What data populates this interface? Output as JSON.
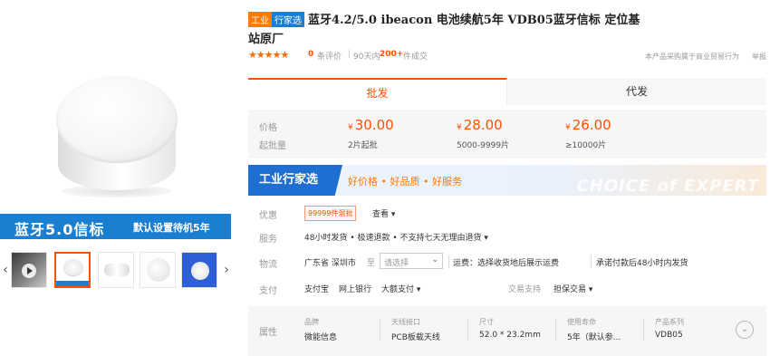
{
  "gallery": {
    "banner_title": "蓝牙5.0信标",
    "banner_subtitle": "默认设置待机5年",
    "prev_arrow": "‹",
    "next_arrow": "›"
  },
  "product": {
    "tag_industry": "工业",
    "tag_select": "行家选",
    "title": "蓝牙4.2/5.0 ibeacon 电池续航5年 VDB05蓝牙信标 定位基站原厂"
  },
  "rating": {
    "stars": "★★★★★",
    "score": "0",
    "reviews_label": "条评价",
    "separator": "|",
    "sold_label": "90天内",
    "sold_count": "200+",
    "sold_unit": "件成交",
    "trade_assurance": "本产品采购属于商业贸易行为",
    "report": "举报"
  },
  "tabs": [
    {
      "label": "批发"
    },
    {
      "label": "代发"
    }
  ],
  "price": {
    "price_label": "价格",
    "moq_label": "起批量",
    "currency": "¥",
    "tiers": [
      {
        "price": "30.00",
        "qty": "2片起批"
      },
      {
        "price": "28.00",
        "qty": "5000-9999片"
      },
      {
        "price": "26.00",
        "qty": "≥10000片"
      }
    ]
  },
  "expert": {
    "label": "工业行家选",
    "slogan": "好价格 • 好品质 • 好服务",
    "watermark": "CHOICE of EXPERT"
  },
  "promo": {
    "label": "优惠",
    "badge": "99999件混批",
    "view": "查看 ▾"
  },
  "service": {
    "label": "服务",
    "text": "48小时发货 • 极速退款 • 不支持七天无理由退货 ▾"
  },
  "shipping": {
    "label": "物流",
    "region": "广东省 深圳市",
    "to": "至",
    "select_placeholder": "请选择",
    "fee": "运费：选择收货地后展示运费",
    "promise": "承诺付款后48小时内发货"
  },
  "payment": {
    "label": "支付",
    "methods": [
      "支付宝",
      "网上银行",
      "大额支付 ▾"
    ],
    "trade_label": "交易支持",
    "trade_value": "担保交易 ▾"
  },
  "attributes": {
    "label": "属性",
    "items": [
      {
        "name": "品牌",
        "value": "微能信息"
      },
      {
        "name": "天线接口",
        "value": "PCB板载天线"
      },
      {
        "name": "尺寸",
        "value": "52.0 * 23.2mm"
      },
      {
        "name": "使用寿命",
        "value": "5年（默认参..."
      },
      {
        "name": "产品系列",
        "value": "VDB05"
      }
    ],
    "more": "⌄"
  },
  "colors": {
    "accent": "#ff5000",
    "brand_blue": "#1a7fd1"
  }
}
